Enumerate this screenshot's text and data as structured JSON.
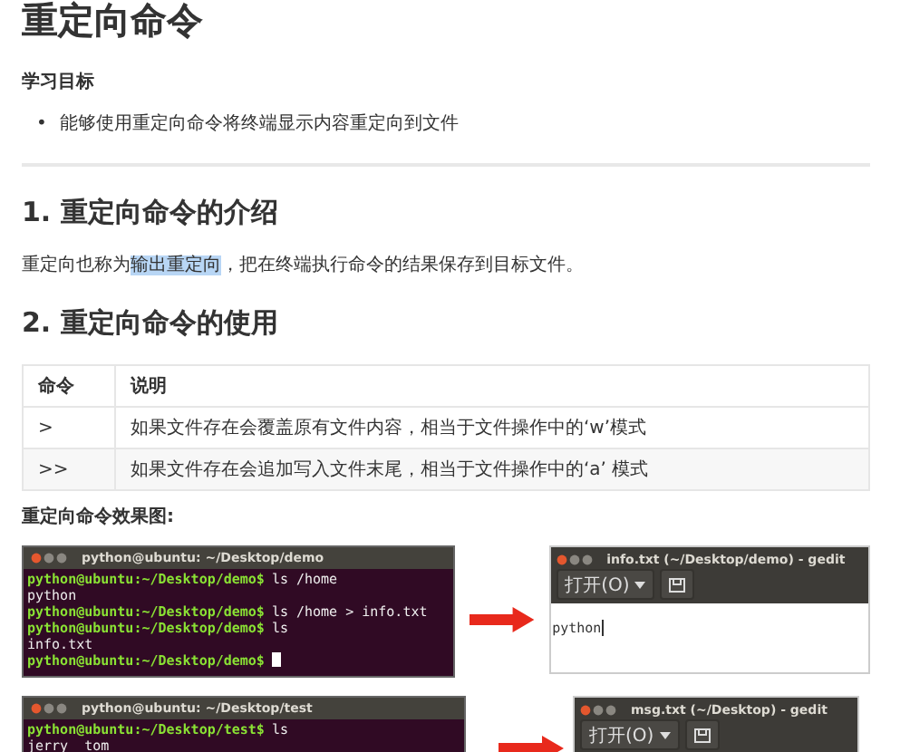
{
  "title": "重定向命令",
  "goal": {
    "heading": "学习目标",
    "bullets": [
      {
        "marker": "•",
        "text": "能够使用重定向命令将终端显示内容重定向到文件"
      }
    ]
  },
  "sections": [
    {
      "heading": "1. 重定向命令的介绍",
      "paragraph": [
        {
          "text": "重定向也称为",
          "highlighted": false
        },
        {
          "text": "输出重定向",
          "highlighted": true
        },
        {
          "text": "，把在终端执行命令的结果保存到目标文件。",
          "highlighted": false
        }
      ]
    },
    {
      "heading": "2. 重定向命令的使用"
    }
  ],
  "table": {
    "columns": [
      "命令",
      "说明"
    ],
    "rows": [
      [
        ">",
        "如果文件存在会覆盖原有文件内容，相当于文件操作中的‘w’模式"
      ],
      [
        ">>",
        "如果文件存在会追加写入文件末尾，相当于文件操作中的‘a’ 模式"
      ]
    ]
  },
  "figure_caption": "重定向命令效果图:",
  "examples": [
    {
      "terminal": {
        "title": "python@ubuntu: ~/Desktop/demo",
        "lines": [
          {
            "kind": "prompt",
            "prompt": "python@ubuntu:~/Desktop/demo$",
            "text": "ls /home"
          },
          {
            "kind": "output",
            "text": "python"
          },
          {
            "kind": "prompt",
            "prompt": "python@ubuntu:~/Desktop/demo$",
            "text": "ls /home > info.txt"
          },
          {
            "kind": "prompt",
            "prompt": "python@ubuntu:~/Desktop/demo$",
            "text": "ls"
          },
          {
            "kind": "output",
            "text": "info.txt"
          },
          {
            "kind": "prompt",
            "prompt": "python@ubuntu:~/Desktop/demo$",
            "cursor": true
          }
        ]
      },
      "editor": {
        "title": "info.txt (~/Desktop/demo) - gedit",
        "open_label": "打开(O)",
        "content": "python"
      }
    },
    {
      "terminal": {
        "title": "python@ubuntu: ~/Desktop/test",
        "lines": [
          {
            "kind": "prompt",
            "prompt": "python@ubuntu:~/Desktop/test$",
            "text": "ls"
          },
          {
            "kind": "output",
            "text": "jerry  tom"
          }
        ]
      },
      "editor": {
        "title": "msg.txt (~/Desktop) - gedit",
        "open_label": "打开(O)"
      }
    }
  ]
}
